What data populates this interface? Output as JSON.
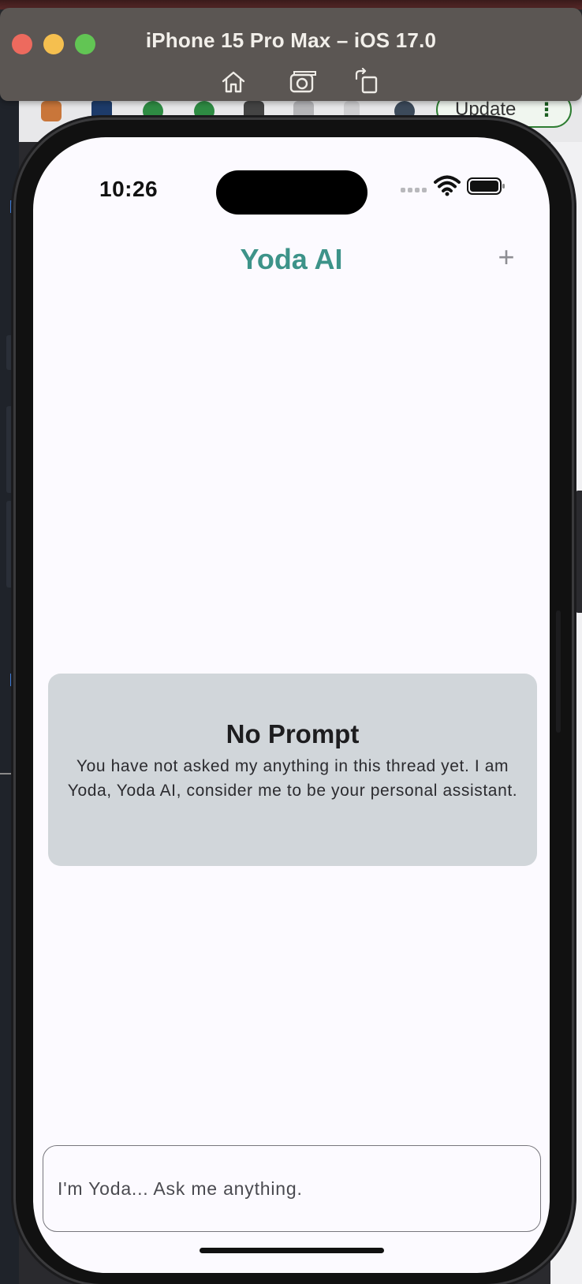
{
  "simulator": {
    "title": "iPhone 15 Pro Max – iOS 17.0",
    "tools": [
      "home-icon",
      "screenshot-icon",
      "rotate-icon"
    ],
    "traffic_colors": {
      "close": "#ed6a5e",
      "minimize": "#f5bf4f",
      "zoom": "#62c554"
    }
  },
  "browser": {
    "update_label": "Update",
    "kebab": "⋮"
  },
  "status_bar": {
    "time": "10:26"
  },
  "header": {
    "title": "Yoda AI",
    "add_symbol": "+"
  },
  "empty_state": {
    "title": "No Prompt",
    "message": "You have not asked my anything in this thread yet. I am Yoda, Yoda AI, consider me to be your personal assistant."
  },
  "prompt": {
    "placeholder": "I'm Yoda... Ask me anything."
  },
  "colors": {
    "accent": "#3d9389",
    "card_bg": "#d1d6da",
    "screen_bg": "#fcfaff"
  }
}
